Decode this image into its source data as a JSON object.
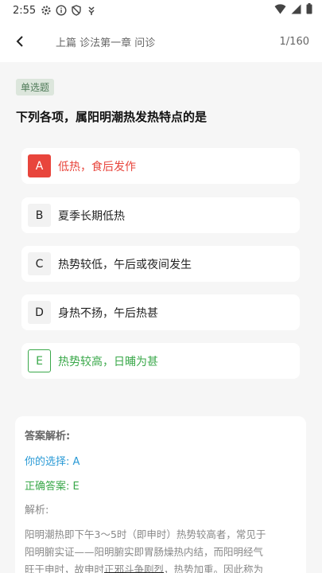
{
  "status": {
    "time": "2:55"
  },
  "header": {
    "title": "上篇 诊法第一章 问诊",
    "pager": "1/160"
  },
  "question": {
    "type": "单选题",
    "text": "下列各项，属阳明潮热发热特点的是",
    "options": [
      {
        "letter": "A",
        "text": "低热，食后发作",
        "state": "wrong"
      },
      {
        "letter": "B",
        "text": "夏季长期低热",
        "state": "normal"
      },
      {
        "letter": "C",
        "text": "热势较低，午后或夜间发生",
        "state": "normal"
      },
      {
        "letter": "D",
        "text": "身热不扬，午后热甚",
        "state": "normal"
      },
      {
        "letter": "E",
        "text": "热势较高，日晡为甚",
        "state": "correct"
      }
    ]
  },
  "analysis": {
    "title": "答案解析:",
    "your_choice": "你的选择: A",
    "correct_answer": "正确答案: E",
    "label": "解析:",
    "line1": "阳明潮热即下午3～5时（即申时）热势较高者，常见于",
    "line2": "阳明腑实证——阳明腑实即胃肠燥热内结，而阳明经气",
    "line3a": "旺于申时，故申时",
    "line3b": "正邪斗争剧烈",
    "line3c": "，热势加重。因此称为"
  },
  "colors": {
    "wrong": "#e8453c",
    "correct": "#3aa84a",
    "your_choice": "#2a9ad6",
    "tag_bg": "#dce6dc"
  }
}
